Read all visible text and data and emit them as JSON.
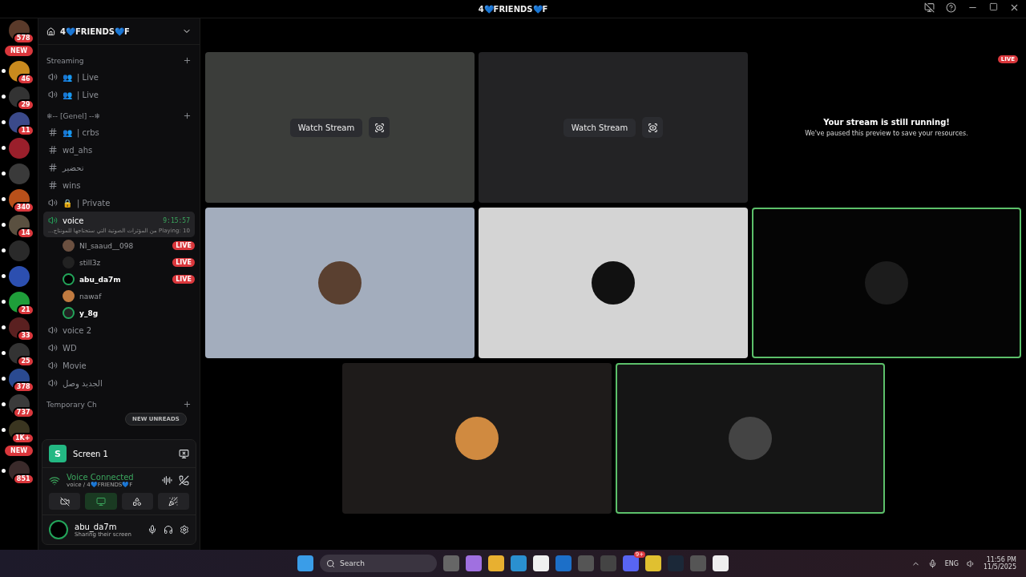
{
  "window": {
    "title": "4💙FRIENDS💙F"
  },
  "rail": [
    {
      "kind": "server",
      "badge": "578",
      "unread": false,
      "color": "#5a3a2a"
    },
    {
      "kind": "new",
      "label": "NEW"
    },
    {
      "kind": "server",
      "badge": "46",
      "unread": true,
      "color": "#c98a1e"
    },
    {
      "kind": "server",
      "badge": "29",
      "unread": true,
      "color": "#333333"
    },
    {
      "kind": "server",
      "badge": "11",
      "unread": true,
      "color": "#3b4a8a"
    },
    {
      "kind": "server",
      "unread": true,
      "color": "#9a1f2b"
    },
    {
      "kind": "server",
      "unread": true,
      "color": "#3a3a3a"
    },
    {
      "kind": "server",
      "badge": "340",
      "unread": true,
      "color": "#b8501a"
    },
    {
      "kind": "server",
      "badge": "14",
      "unread": true,
      "color": "#5a5040"
    },
    {
      "kind": "server",
      "unread": true,
      "color": "#2a2a2a"
    },
    {
      "kind": "server",
      "unread": true,
      "color": "#2c4fb0"
    },
    {
      "kind": "server",
      "badge": "21",
      "unread": true,
      "color": "#1f9e3a"
    },
    {
      "kind": "server",
      "badge": "33",
      "unread": true,
      "color": "#5a2020"
    },
    {
      "kind": "server",
      "badge": "25",
      "unread": true,
      "color": "#333333"
    },
    {
      "kind": "server",
      "badge": "378",
      "unread": true,
      "color": "#2a4a90"
    },
    {
      "kind": "server",
      "badge": "737",
      "unread": true,
      "color": "#3a3a3a"
    },
    {
      "kind": "server",
      "badge": "1K+",
      "unread": true,
      "color": "#3a3520"
    },
    {
      "kind": "new",
      "label": "NEW"
    },
    {
      "kind": "server",
      "badge": "851",
      "unread": true,
      "color": "#3a2a2a"
    }
  ],
  "server": {
    "name": "4💙FRIENDS💙F"
  },
  "categories": [
    {
      "name": "Streaming",
      "channels": [
        {
          "kind": "voice",
          "name": "| Live",
          "emoji": "👥",
          "selected": false
        },
        {
          "kind": "voice",
          "name": "| Live",
          "emoji": "👥",
          "selected": false
        }
      ]
    },
    {
      "name": "❄-- [Genel] --❄",
      "channels": [
        {
          "kind": "text",
          "name": "| crbs",
          "emoji": "👥",
          "selected": false
        },
        {
          "kind": "text",
          "name": "wd_ahs",
          "selected": false
        },
        {
          "kind": "text",
          "name": "تحضير",
          "selected": false
        },
        {
          "kind": "text",
          "name": "wins",
          "selected": false
        },
        {
          "kind": "voice",
          "name": "| Private",
          "emoji": "🔒",
          "selected": false
        },
        {
          "kind": "voice",
          "name": "voice",
          "selected": true,
          "timer": "9:15:57",
          "activity": "Playing: 10 من المؤثرات الصوتية التي ستحتاجها للمونتاج...",
          "members": [
            {
              "name": "NI_saaud__098",
              "live": true,
              "badge": "LIVE",
              "speaking": false,
              "color": "#6b5040"
            },
            {
              "name": "still3z",
              "live": true,
              "badge": "LIVE",
              "speaking": false,
              "color": "#222222"
            },
            {
              "name": "abu_da7m",
              "live": true,
              "badge": "LIVE",
              "speaking": true,
              "color": "#000000"
            },
            {
              "name": "nawaf",
              "live": false,
              "speaking": false,
              "color": "#c07a40"
            },
            {
              "name": "y_8g",
              "live": false,
              "speaking": true,
              "color": "#222222"
            }
          ]
        },
        {
          "kind": "voice",
          "name": "voice 2",
          "selected": false
        },
        {
          "kind": "voice",
          "name": "WD",
          "selected": false
        },
        {
          "kind": "voice",
          "name": "Movie",
          "selected": false
        },
        {
          "kind": "voice",
          "name": "الجديد وصل",
          "selected": false
        }
      ]
    },
    {
      "name": "Temporary Ch"
    }
  ],
  "new_unreads": "NEW UNREADS",
  "screen_panel": {
    "title": "Screen 1",
    "letter": "S"
  },
  "voice_panel": {
    "status": "Voice Connected",
    "location": "voice / 4💙FRIENDS💙F"
  },
  "user_panel": {
    "name": "abu_da7m",
    "status": "Sharing their screen"
  },
  "tiles": [
    {
      "kind": "stream",
      "speaking": false,
      "button": "Watch Stream"
    },
    {
      "kind": "stream",
      "speaking": false,
      "button": "Watch Stream"
    },
    {
      "kind": "paused",
      "speaking": false,
      "badge": "LIVE",
      "title": "Your stream is still running!",
      "text": "We've paused this preview to save your resources."
    },
    {
      "kind": "user",
      "speaking": false
    },
    {
      "kind": "user",
      "speaking": false
    },
    {
      "kind": "user",
      "speaking": true
    },
    {
      "kind": "user",
      "speaking": false
    },
    {
      "kind": "user",
      "speaking": true
    }
  ],
  "taskbar": {
    "search": "Search",
    "discord_badge": "9+",
    "lang": "ENG",
    "time": "11:56 PM",
    "date": "11/5/2025"
  }
}
